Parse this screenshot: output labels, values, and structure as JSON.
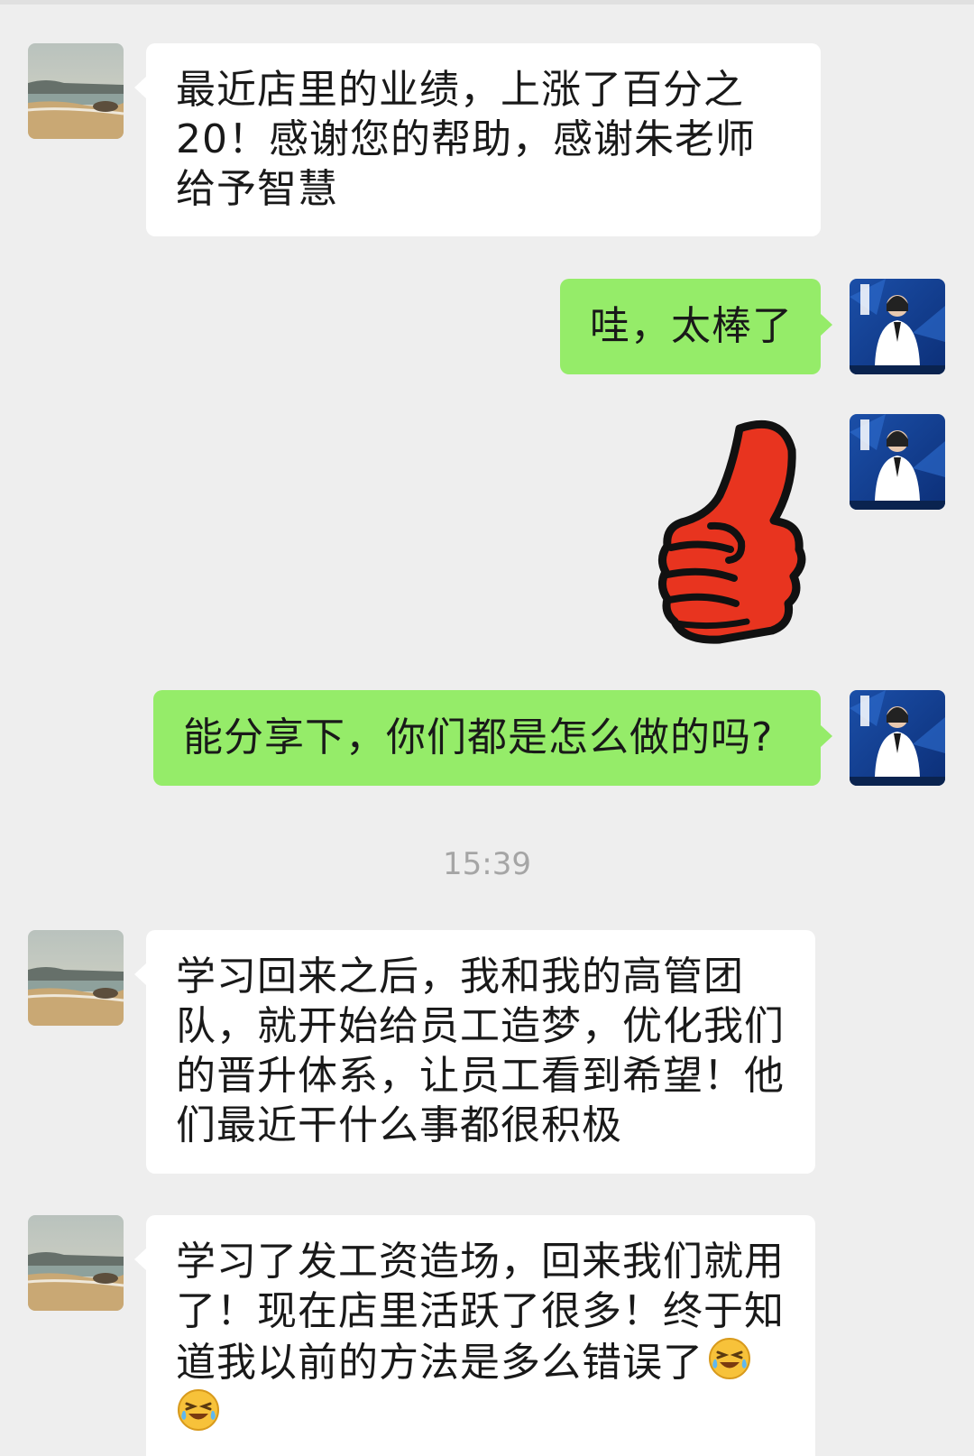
{
  "chat": {
    "timestamp": "15:39",
    "messages": [
      {
        "sender": "contact",
        "type": "text",
        "text": "最近店里的业绩，上涨了百分之20！感谢您的帮助，感谢朱老师给予智慧"
      },
      {
        "sender": "me",
        "type": "text",
        "text": "哇，太棒了"
      },
      {
        "sender": "me",
        "type": "sticker",
        "sticker": "thumbs-up"
      },
      {
        "sender": "me",
        "type": "text",
        "text": "能分享下，你们都是怎么做的吗?"
      },
      {
        "sender": "contact",
        "type": "text",
        "text": "学习回来之后，我和我的高管团队，就开始给员工造梦，优化我们的晋升体系，让员工看到希望！他们最近干什么事都很积极"
      },
      {
        "sender": "contact",
        "type": "text",
        "text": "学习了发工资造场，回来我们就用了！现在店里活跃了很多！终于知道我以前的方法是多么错误了",
        "emoji": [
          "crying-laughing-face",
          "crying-laughing-face"
        ]
      }
    ]
  },
  "colors": {
    "background": "#eeeeee",
    "incoming_bubble": "#ffffff",
    "outgoing_bubble": "#95ec69",
    "timestamp": "#a5a5a5",
    "sticker_red": "#e8341f"
  }
}
